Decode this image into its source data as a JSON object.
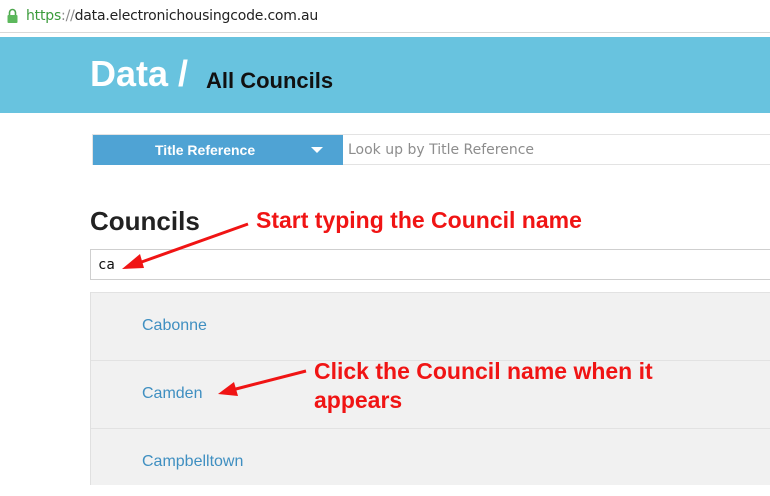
{
  "address_bar": {
    "scheme": "https",
    "separator": "://",
    "host": "data.electronichousingcode.com.au"
  },
  "header": {
    "brand": "Data /",
    "section": "All Councils",
    "background": "#68c3df"
  },
  "lookup": {
    "dropdown_label": "Title Reference",
    "input_placeholder": "Look up by Title Reference",
    "dropdown_color": "#4fa3d4"
  },
  "councils": {
    "title": "Councils",
    "search_value": "ca",
    "results": [
      {
        "name": "Cabonne"
      },
      {
        "name": "Camden"
      },
      {
        "name": "Campbelltown"
      }
    ],
    "link_color": "#3f8fc1"
  },
  "annotations": {
    "typing_hint": "Start typing the Council name",
    "click_hint_line1": "Click the Council name when it",
    "click_hint_line2": "appears",
    "color": "#f01414"
  }
}
